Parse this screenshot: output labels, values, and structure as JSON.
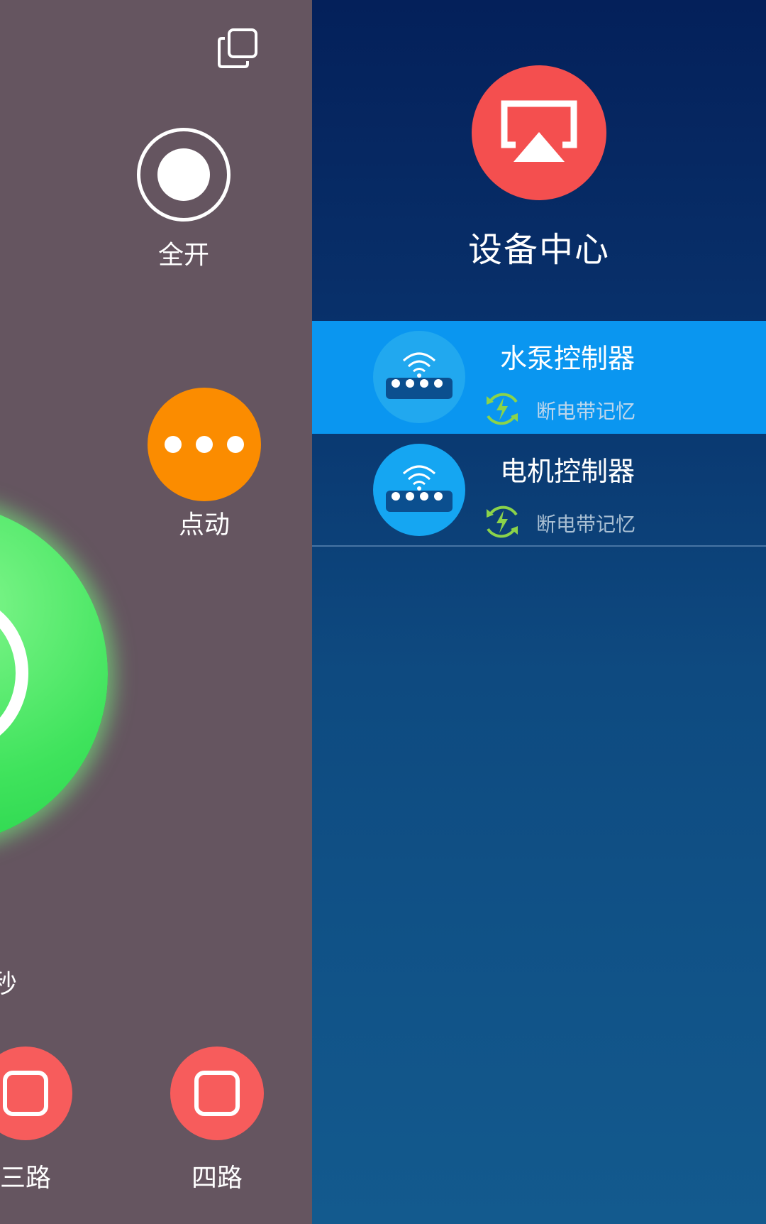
{
  "left_panel": {
    "all_on_label": "全开",
    "jog_label": "点动",
    "seconds_fragment": "秒",
    "channels": [
      {
        "label": "三路"
      },
      {
        "label": "四路"
      }
    ],
    "colors": {
      "background": "#655560",
      "power_button": "#3fe35c",
      "jog_button": "#fb8c00",
      "stop_button": "#f75c5c"
    }
  },
  "drawer": {
    "title": "设备中心",
    "header_icon": "screen-cast-icon",
    "devices": [
      {
        "name": "水泵控制器",
        "status": "断电带记忆",
        "icon": "wifi-router-icon",
        "selected": true
      },
      {
        "name": "电机控制器",
        "status": "断电带记忆",
        "icon": "wifi-router-icon",
        "selected": false
      }
    ],
    "colors": {
      "gradient_top": "#04205a",
      "gradient_bottom": "#135a8e",
      "selected_row": "#0a96f0",
      "cast_icon": "#f44f4f"
    }
  }
}
